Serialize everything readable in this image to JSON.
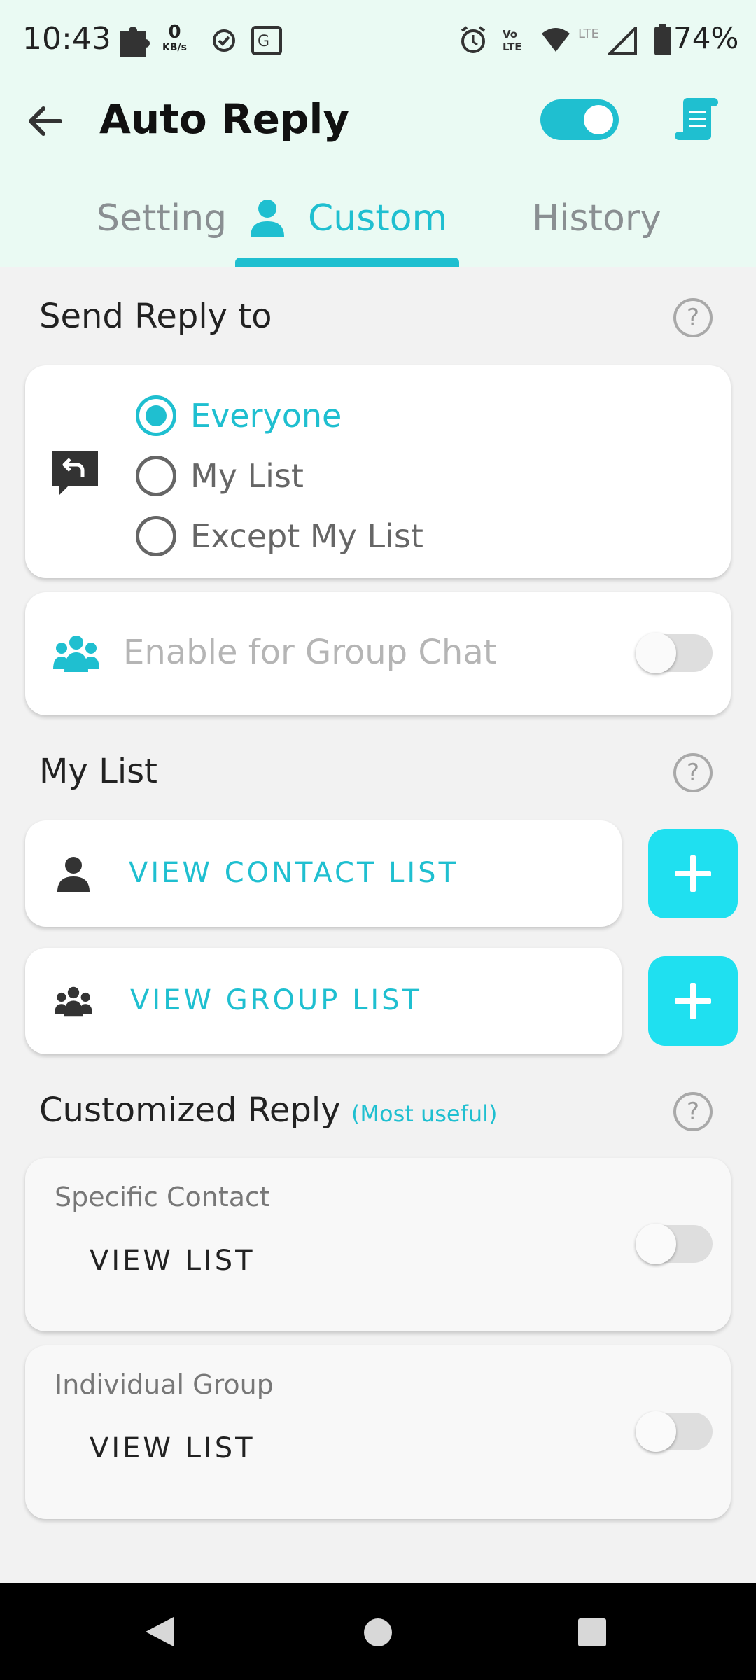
{
  "status_bar": {
    "time": "10:43",
    "net_speed_value": "0",
    "net_speed_unit": "KB/s",
    "battery": "74%",
    "icons": [
      "notification-icon",
      "check-circle-icon",
      "translate-icon",
      "alarm-icon",
      "volte-icon",
      "wifi-icon",
      "lte-icon",
      "signal-icon",
      "battery-icon"
    ]
  },
  "app_bar": {
    "title": "Auto Reply",
    "master_toggle_on": true
  },
  "tabs": [
    {
      "label": "Setting",
      "active": false
    },
    {
      "label": "Custom",
      "active": true
    },
    {
      "label": "History",
      "active": false
    }
  ],
  "send_reply": {
    "title": "Send Reply to",
    "options": [
      {
        "label": "Everyone",
        "selected": true
      },
      {
        "label": "My List",
        "selected": false
      },
      {
        "label": "Except My List",
        "selected": false
      }
    ],
    "group_chat_label": "Enable for Group Chat",
    "group_chat_enabled": false
  },
  "my_list": {
    "title": "My List",
    "contact_label": "VIEW CONTACT LIST",
    "group_label": "VIEW GROUP LIST"
  },
  "customized_reply": {
    "title": "Customized Reply",
    "hint": "(Most useful)",
    "items": [
      {
        "subtitle": "Specific Contact",
        "view_label": "VIEW LIST",
        "enabled": false
      },
      {
        "subtitle": "Individual Group",
        "view_label": "VIEW LIST",
        "enabled": false
      }
    ]
  },
  "help_symbol": "?",
  "colors": {
    "accent": "#1fbfd0",
    "plus_button": "#1fe0f0",
    "header_bg": "#eafaf3",
    "page_bg": "#f2f2f2"
  }
}
